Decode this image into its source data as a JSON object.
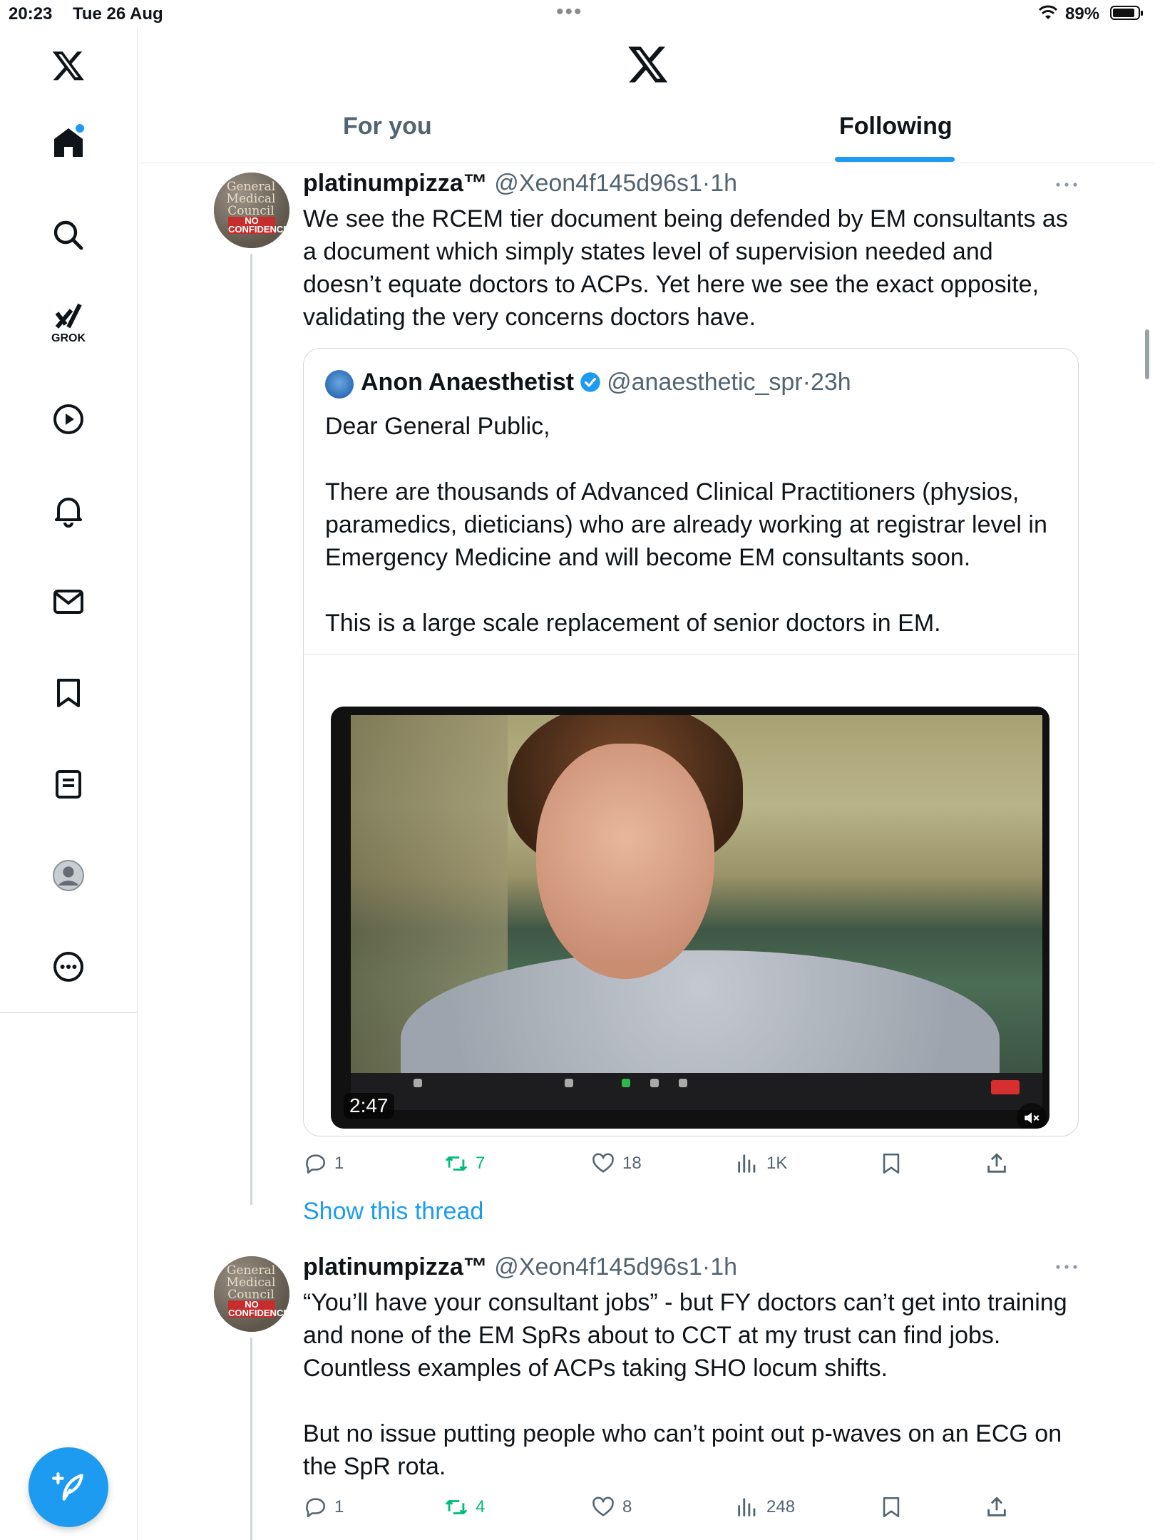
{
  "status_bar": {
    "time": "20:23",
    "date": "Tue 26 Aug",
    "battery": "89%",
    "battery_level": 0.89
  },
  "sidebar": {
    "items": [
      {
        "icon": "x-logo-icon"
      },
      {
        "icon": "home-icon"
      },
      {
        "icon": "search-icon"
      },
      {
        "icon": "grok-icon",
        "label": "GROK"
      },
      {
        "icon": "play-icon"
      },
      {
        "icon": "bell-icon"
      },
      {
        "icon": "mail-icon"
      },
      {
        "icon": "bookmark-icon"
      },
      {
        "icon": "list-icon"
      },
      {
        "icon": "profile-icon"
      },
      {
        "icon": "more-icon"
      }
    ],
    "compose_icon": "compose-post-icon"
  },
  "header": {
    "tabs": [
      {
        "label": "For you",
        "active": false
      },
      {
        "label": "Following",
        "active": true
      }
    ]
  },
  "tweets": [
    {
      "name": "platinumpizza™",
      "handle": "@Xeon4f145d96s1",
      "time": "1h",
      "avatar_text": "General Medical Council",
      "avatar_badge": "NO CONFIDENCE",
      "text": "We see the RCEM tier document being defended by EM consultants as a document which simply states level of supervision needed and doesn’t equate doctors to ACPs. Yet here we see the exact opposite, validating the very concerns doctors have.",
      "quote": {
        "name": "Anon Anaesthetist",
        "handle": "@anaesthetic_spr",
        "time": "23h",
        "verified": true,
        "text": "Dear General Public,\n\nThere are thousands of Advanced Clinical Practitioners (physios, paramedics, dieticians) who are already working at registrar level in Emergency Medicine and will become EM consultants soon.\n\nThis is a large scale replacement of senior doctors in EM.",
        "video_duration": "2:47"
      },
      "replies": "1",
      "reposts": "7",
      "likes": "18",
      "views": "1K"
    },
    {
      "name": "platinumpizza™",
      "handle": "@Xeon4f145d96s1",
      "time": "1h",
      "avatar_text": "General Medical Council",
      "avatar_badge": "NO CONFIDENCE",
      "text": "“You’ll have your consultant jobs” - but FY doctors can’t get into training and none of the EM SpRs about to CCT at my trust can find jobs. Countless examples of ACPs taking SHO locum shifts.\n\nBut no issue putting people who can’t point out p-waves on an ECG on the SpR rota.",
      "replies": "1",
      "reposts": "4",
      "likes": "8",
      "views": "248"
    }
  ],
  "show_thread": "Show this thread",
  "colors": {
    "accent": "#1d9bf0",
    "repost_active": "#00ba7c",
    "secondary_text": "#536471"
  }
}
